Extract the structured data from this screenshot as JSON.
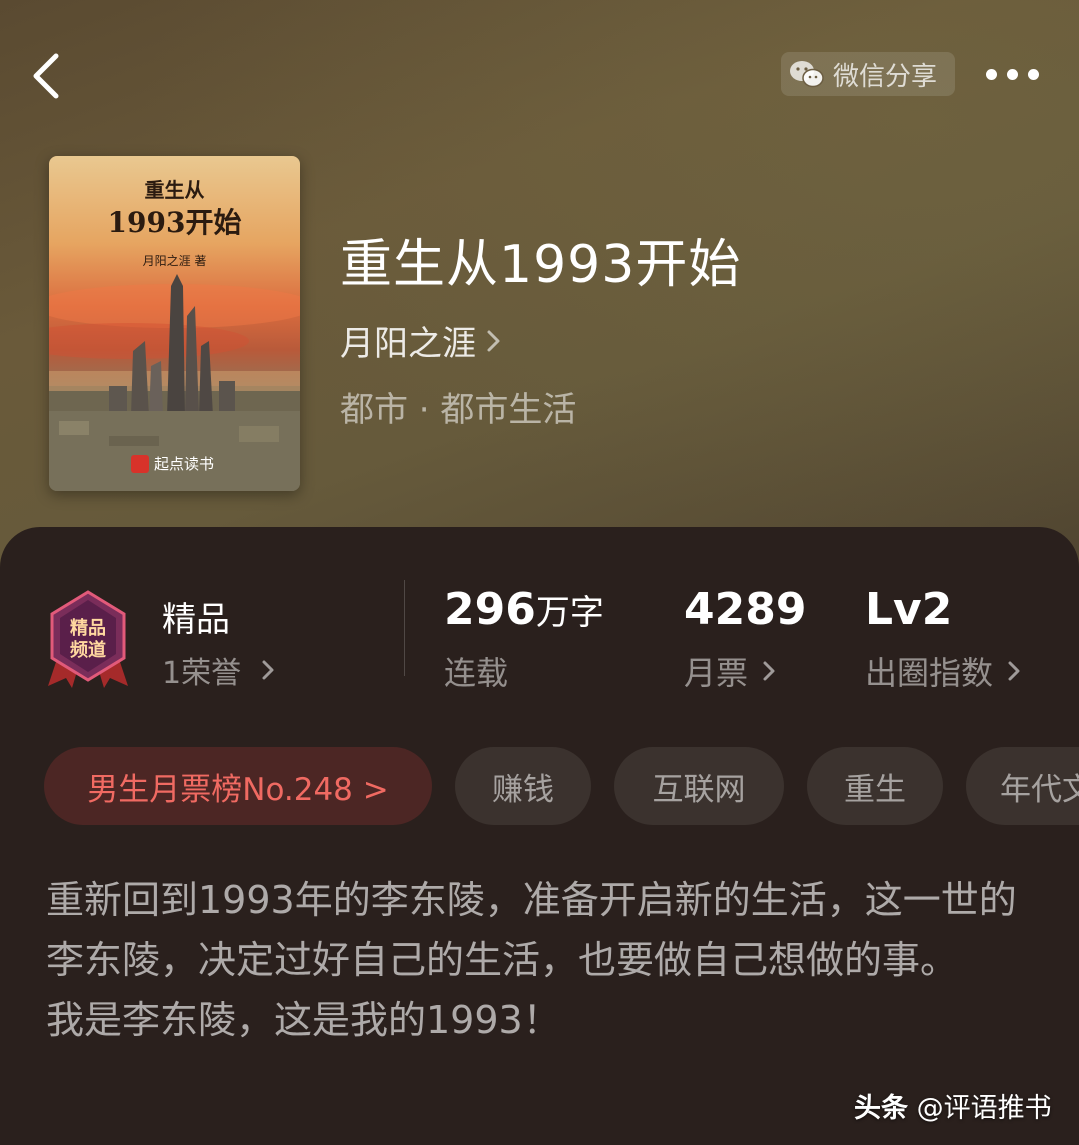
{
  "header": {
    "share_label": "微信分享",
    "icons": [
      "back-icon",
      "wechat-icon",
      "more-icon"
    ]
  },
  "cover": {
    "title_pre": "重生从",
    "title_main": "1993开始",
    "author": "月阳之涯 著",
    "publisher": "起点读书"
  },
  "book": {
    "title": "重生从1993开始",
    "author": "月阳之涯",
    "category": "都市 · 都市生活"
  },
  "honor": {
    "badge_text": "精品频道",
    "title": "精品",
    "sub": "1荣誉"
  },
  "stats": [
    {
      "value": "296",
      "unit": "万字",
      "label": "连载"
    },
    {
      "value": "4289",
      "unit": "",
      "label": "月票"
    },
    {
      "value": "Lv2",
      "unit": "",
      "label": "出圈指数"
    }
  ],
  "tags": {
    "rank": "男生月票榜No.248 >",
    "items": [
      "赚钱",
      "互联网",
      "重生",
      "年代文"
    ]
  },
  "description": [
    "重新回到1993年的李东陵，准备开启新的生活，这一世的李东陵，决定过好自己的生活，也要做自己想做的事。",
    "我是李东陵，这是我的1993！"
  ],
  "watermark": {
    "brand": "头条",
    "handle": "@评语推书"
  },
  "colors": {
    "header_bg": "#5f4f35",
    "panel_bg": "#2a201d",
    "rank_text": "#f06a62",
    "rank_bg": "#4c2624",
    "chip_bg": "#3b322e"
  }
}
